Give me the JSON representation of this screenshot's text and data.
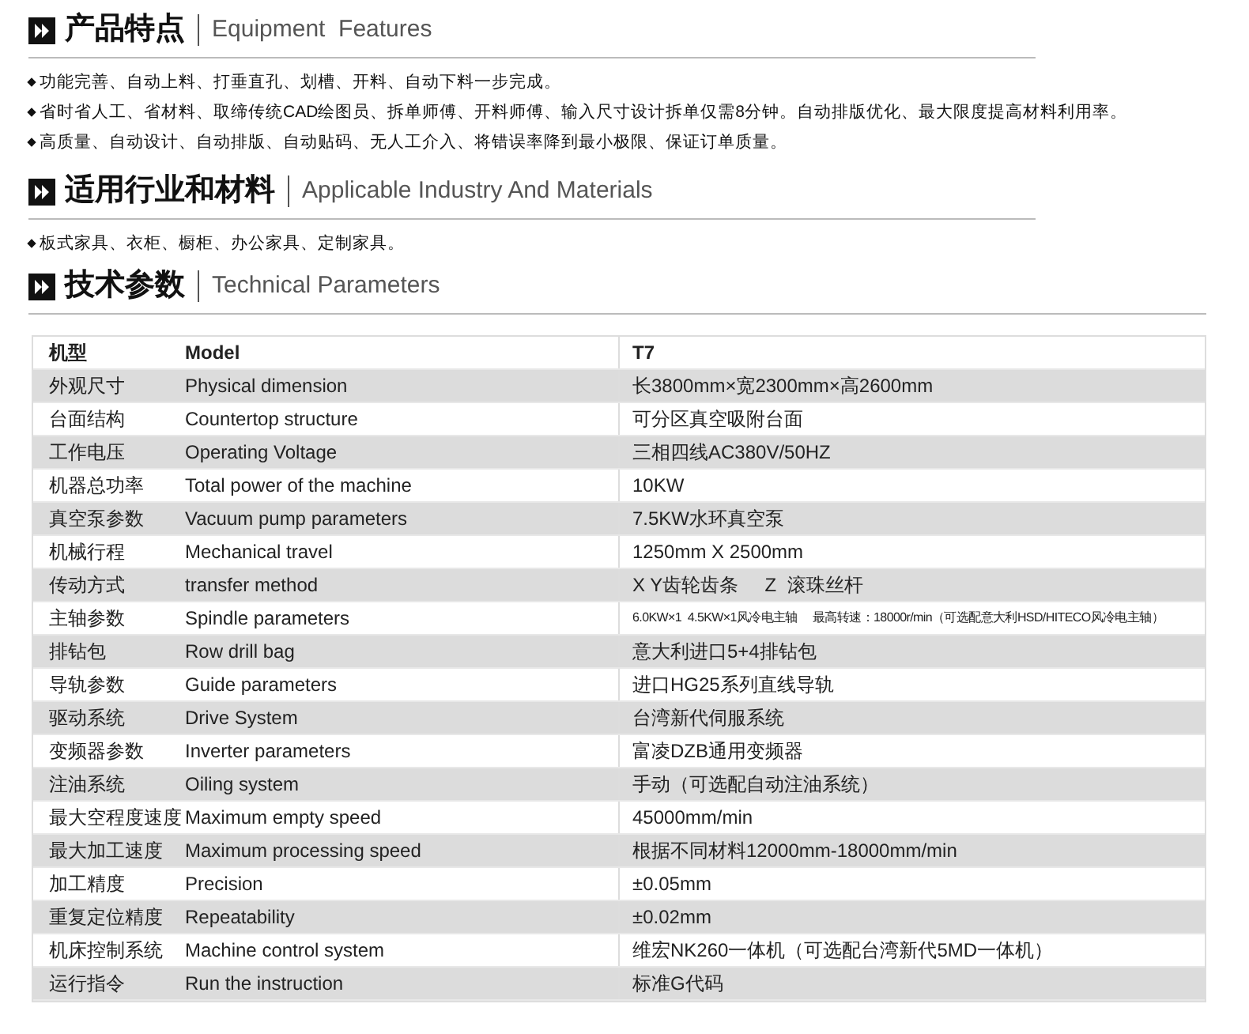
{
  "sections": [
    {
      "title": "产品特点",
      "subtitle": "Equipment  Features",
      "bullets": [
        "功能完善、自动上料、打垂直孔、划槽、开料、自动下料一步完成。",
        "省时省人工、省材料、取缔传统CAD绘图员、拆单师傅、开料师傅、输入尺寸设计拆单仅需8分钟。自动排版优化、最大限度提高材料利用率。",
        "高质量、自动设计、自动排版、自动贴码、无人工介入、将错误率降到最小极限、保证订单质量。"
      ]
    },
    {
      "title": "适用行业和材料",
      "subtitle": "Applicable Industry And Materials",
      "bullets": [
        "板式家具、衣柜、橱柜、办公家具、定制家具。"
      ]
    },
    {
      "title": "技术参数",
      "subtitle": "Technical Parameters"
    }
  ],
  "table": {
    "header": [
      "机型",
      "Model",
      "T7"
    ],
    "rows": [
      {
        "cn": "外观尺寸",
        "en": "Physical dimension",
        "value": "长3800mm×宽2300mm×高2600mm"
      },
      {
        "cn": "台面结构",
        "en": "Countertop structure",
        "value": "可分区真空吸附台面"
      },
      {
        "cn": "工作电压",
        "en": "Operating Voltage",
        "value": "三相四线AC380V/50HZ"
      },
      {
        "cn": "机器总功率",
        "en": "Total power of the machine",
        "value": "10KW"
      },
      {
        "cn": "真空泵参数",
        "en": "Vacuum pump parameters",
        "value": "7.5KW水环真空泵"
      },
      {
        "cn": "机械行程",
        "en": "Mechanical travel",
        "value": "1250mm X 2500mm"
      },
      {
        "cn": "传动方式",
        "en": "transfer method",
        "value": "X Y齿轮齿条     Z  滚珠丝杆"
      },
      {
        "cn": "主轴参数",
        "en": "Spindle parameters",
        "value": "6.0KW×1  4.5KW×1风冷电主轴     最高转速：18000r/min（可选配意大利HSD/HITECO风冷电主轴）",
        "small": true
      },
      {
        "cn": "排钻包",
        "en": "Row drill bag",
        "value": "意大利进口5+4排钻包"
      },
      {
        "cn": "导轨参数",
        "en": "Guide parameters",
        "value": "进口HG25系列直线导轨"
      },
      {
        "cn": "驱动系统",
        "en": "Drive System",
        "value": "台湾新代伺服系统"
      },
      {
        "cn": "变频器参数",
        "en": "Inverter parameters",
        "value": "富凌DZB通用变频器"
      },
      {
        "cn": "注油系统",
        "en": "Oiling system",
        "value": "手动（可选配自动注油系统）"
      },
      {
        "cn": "最大空程度速度",
        "en": "Maximum empty speed",
        "value": "45000mm/min"
      },
      {
        "cn": "最大加工速度",
        "en": "Maximum processing speed",
        "value": "根据不同材料12000mm-18000mm/min"
      },
      {
        "cn": "加工精度",
        "en": "Precision",
        "value": "±0.05mm"
      },
      {
        "cn": "重复定位精度",
        "en": "Repeatability",
        "value": "±0.02mm"
      },
      {
        "cn": "机床控制系统",
        "en": "Machine control system",
        "value": "维宏NK260一体机（可选配台湾新代5MD一体机）"
      },
      {
        "cn": "运行指令",
        "en": "Run the instruction",
        "value": "标准G代码"
      }
    ]
  }
}
